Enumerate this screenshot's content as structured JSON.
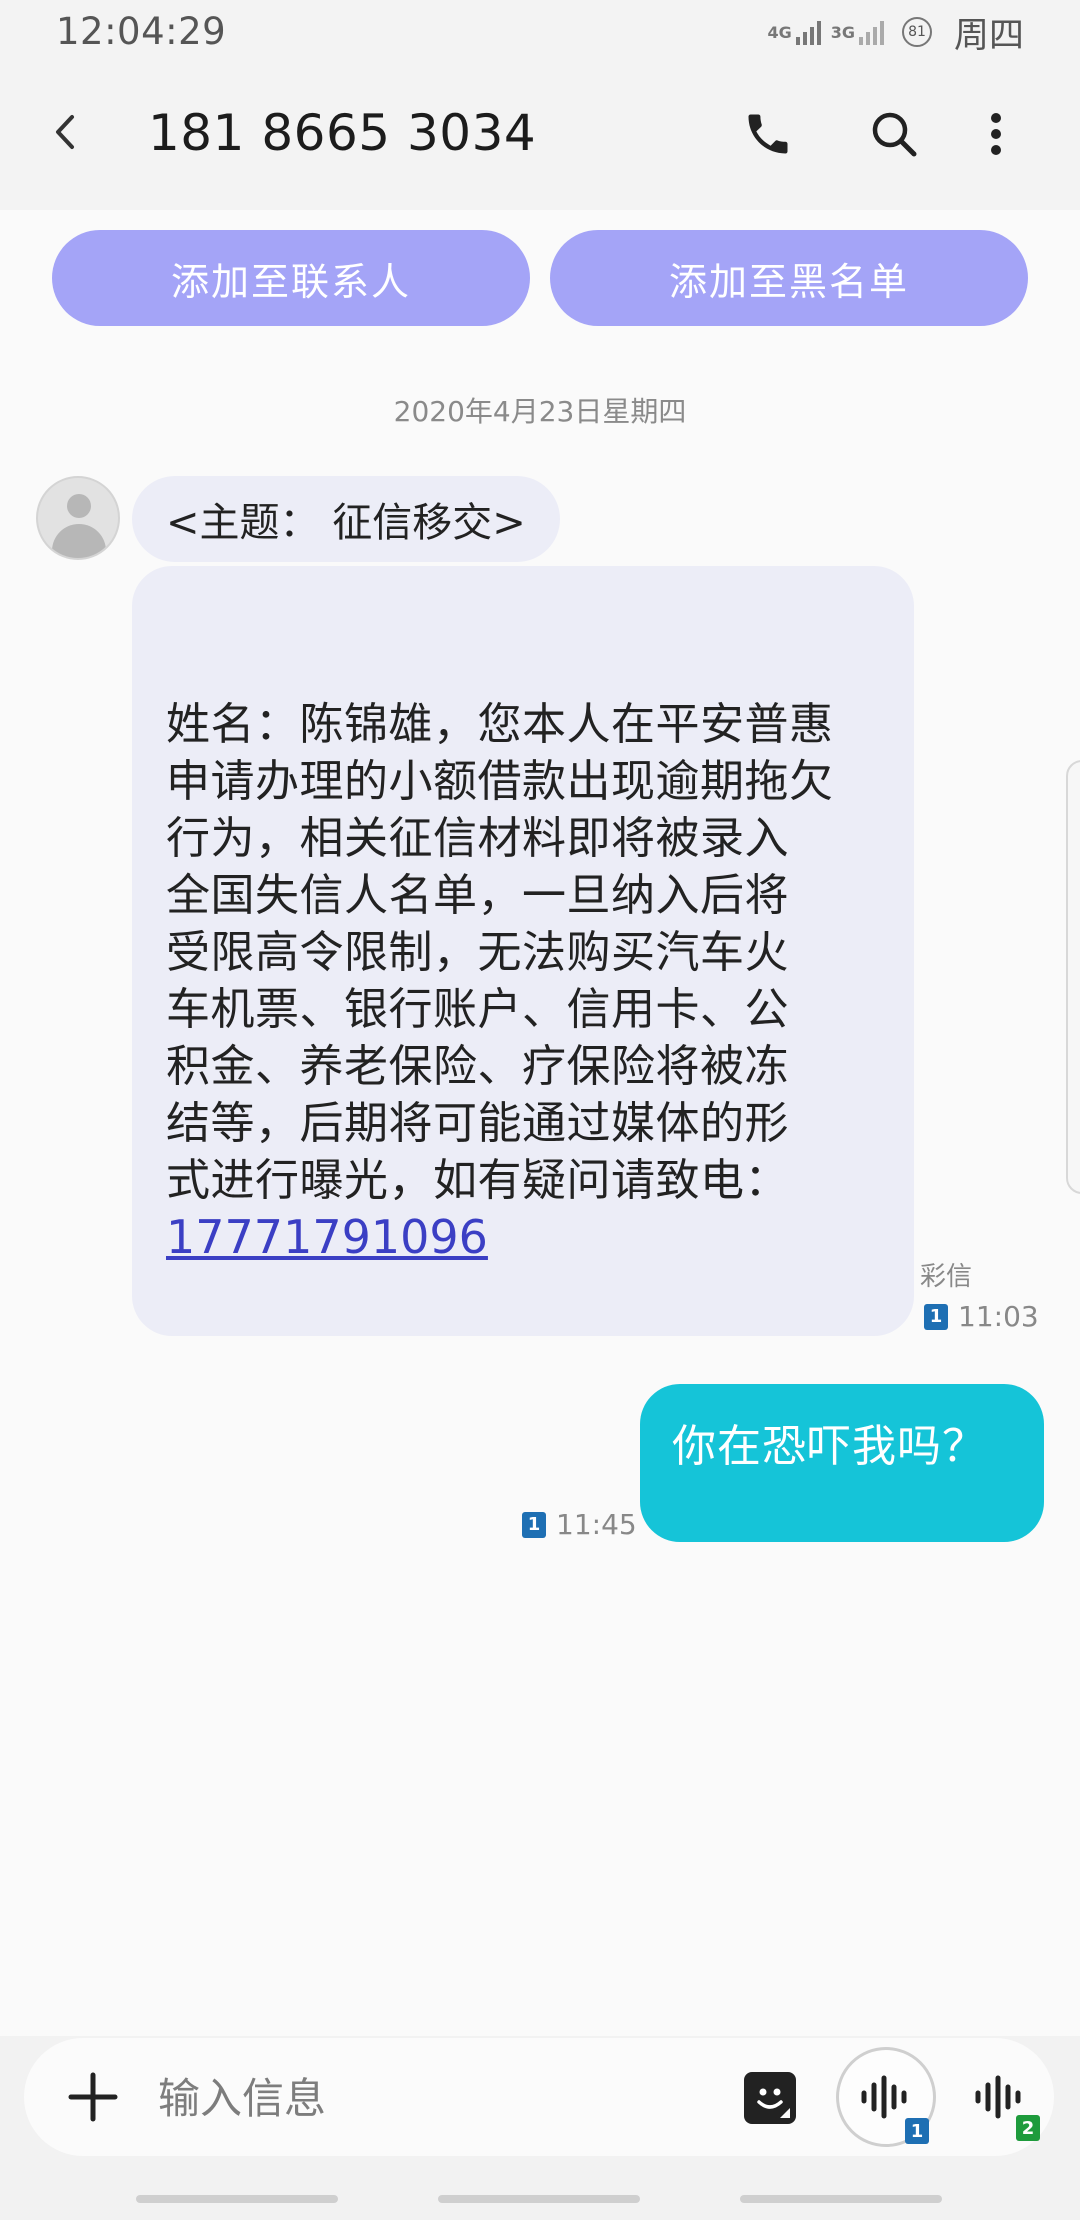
{
  "status_bar": {
    "time": "12:04:29",
    "network_1": "4G",
    "network_2": "3G",
    "battery": "81",
    "day": "周四"
  },
  "header": {
    "title": "181 8665 3034",
    "back_icon": "back-arrow-icon",
    "call_icon": "phone-icon",
    "search_icon": "search-icon",
    "more_icon": "more-vertical-icon"
  },
  "actions": {
    "add_contact": "添加至联系人",
    "add_blacklist": "添加至黑名单"
  },
  "conversation": {
    "date": "2020年4月23日星期四",
    "incoming": {
      "subject": "<主题： 征信移交>",
      "body": "姓名：陈锦雄，您本人在平安普惠\n申请办理的小额借款出现逾期拖欠\n行为，相关征信材料即将被录入\n全国失信人名单，一旦纳入后将\n受限高令限制，无法购买汽车火\n车机票、银行账户、信用卡、公\n积金、养老保险、疗保险将被冻\n结等，后期将可能通过媒体的形\n式进行曝光，如有疑问请致电：",
      "link": "17771791096",
      "type_label": "彩信",
      "sim": "1",
      "time": "11:03"
    },
    "outgoing": {
      "text": "你在恐吓我吗？",
      "sim": "1",
      "time": "11:45"
    }
  },
  "compose": {
    "placeholder": "输入信息",
    "plus_icon": "plus-icon",
    "sticker_icon": "sticker-icon",
    "voice_sim_1": "1",
    "voice_sim_2": "2"
  },
  "colors": {
    "action_button": "#a4a4f7",
    "incoming_bubble": "#ecedf7",
    "outgoing_bubble": "#15c4d8",
    "link": "#3b3fc4",
    "sim_1": "#1e6fb3",
    "sim_2": "#1e9b3c"
  }
}
